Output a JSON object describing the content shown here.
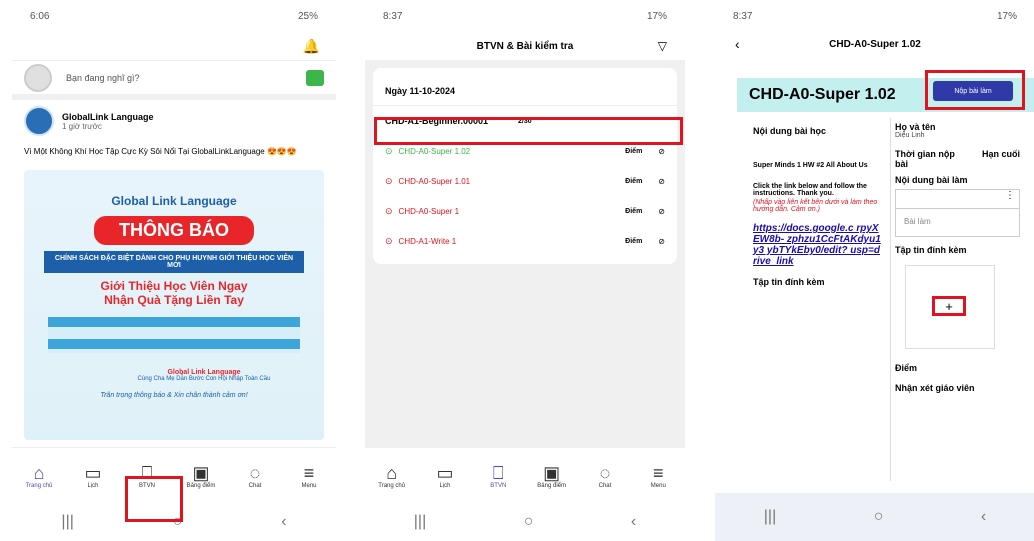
{
  "phone1": {
    "status_time": "6:06",
    "status_right": "25%",
    "post_prompt": "Bạn đang nghĩ gì?",
    "post_author": "GlobalLink Language",
    "post_time": "1 giờ trước",
    "post_text": "Vì Một Không Khí Học Tập Cực Kỳ Sôi Nổi Tại GlobalLinkLanguage 😍😍😍",
    "banner": {
      "brand": "Global Link Language",
      "headline": "THÔNG BÁO",
      "policy": "CHÍNH SÁCH ĐẶC BIỆT DÀNH CHO PHỤ HUYNH GIỚI THIỆU HỌC VIÊN MỚI",
      "slogan1": "Giới Thiệu Học Viên Ngay",
      "slogan2": "Nhận Quà Tặng Liền Tay",
      "footer_brand": "Global Link Language",
      "footer_sub": "Cùng Cha Mẹ Dẫn Bước Con Hội Nhập Toàn Cầu",
      "thanks": "Trân trọng thông báo & Xin chân thành cảm ơn!"
    },
    "tabs": [
      "Trang chủ",
      "Lịch",
      "BTVN",
      "Bảng điểm",
      "Chat",
      "Menu"
    ]
  },
  "phone2": {
    "status_time": "8:37",
    "status_right": "17%",
    "title": "BTVN & Bài kiểm tra",
    "date": "Ngày 11-10-2024",
    "class_name": "CHD-A1-Beginner.00001",
    "class_count": "2/30",
    "items": [
      {
        "name": "CHD-A0-Super 1.02",
        "score": "Điểm"
      },
      {
        "name": "CHD-A0-Super 1.01",
        "score": "Điểm"
      },
      {
        "name": "CHD-A0-Super 1",
        "score": "Điểm"
      },
      {
        "name": "CHD-A1-Write 1",
        "score": "Điểm"
      }
    ],
    "tabs": [
      "Trang chủ",
      "Lịch",
      "BTVN",
      "Bảng điểm",
      "Chat",
      "Menu"
    ]
  },
  "phone3": {
    "status_time": "8:37",
    "status_right": "17%",
    "title": "CHD-A0-Super 1.02",
    "heading": "CHD-A0-Super 1.02",
    "submit_label": "Nộp bài làm",
    "content_label": "Nội dung bài học",
    "lesson_title": "Super Minds 1 HW #2 All About Us",
    "instructions": "Click the link below and follow the instructions. Thank you.",
    "instructions_vi": "(Nhấp vào liên kết bên dưới và làm theo hướng dẫn. Cảm ơn.)",
    "link": "https://docs.google.com/rpyXEW8b-zphzu1CcFtAKdyu1y3ybTYkEby0/edit?usp=drive_link",
    "link_display": "https://docs.google.c rpyXEW8b- zphzu1CcFtAKdyu1y3 ybTYkEby0/edit? usp=drive_link",
    "attach_left": "Tập tin đính kèm",
    "name_label": "Họ và tên",
    "name_value": "Diệu Linh",
    "time_label": "Thời gian nộp bài",
    "deadline_label": "Hạn cuối",
    "work_label": "Nội dung bài làm",
    "work_placeholder": "Bài làm",
    "attach_right": "Tập tin đính kèm",
    "score_label": "Điểm",
    "comment_label": "Nhận xét giáo viên"
  }
}
